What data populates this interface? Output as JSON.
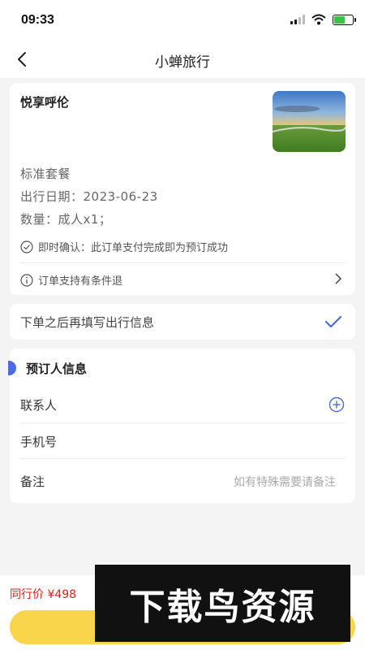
{
  "status": {
    "time": "09:33"
  },
  "nav": {
    "title": "小蝉旅行"
  },
  "product": {
    "name": "悦享呼伦",
    "package": "标准套餐",
    "date": "出行日期：2023-06-23",
    "quantity": "数量：成人x1；",
    "confirm": "即时确认：此订单支付完成即为预订成功",
    "refund": "订单支持有条件退"
  },
  "later": {
    "text": "下单之后再填写出行信息"
  },
  "booker": {
    "title": "预订人信息",
    "contact_label": "联系人",
    "phone_label": "手机号",
    "remark_label": "备注",
    "remark_placeholder": "如有特殊需要请备注"
  },
  "bottom": {
    "price_label": "同行价 ¥498"
  },
  "watermark": {
    "text": "下载鸟资源"
  },
  "colors": {
    "accent": "#4b6be0",
    "price": "#e0201a",
    "button": "#f8d54a"
  }
}
